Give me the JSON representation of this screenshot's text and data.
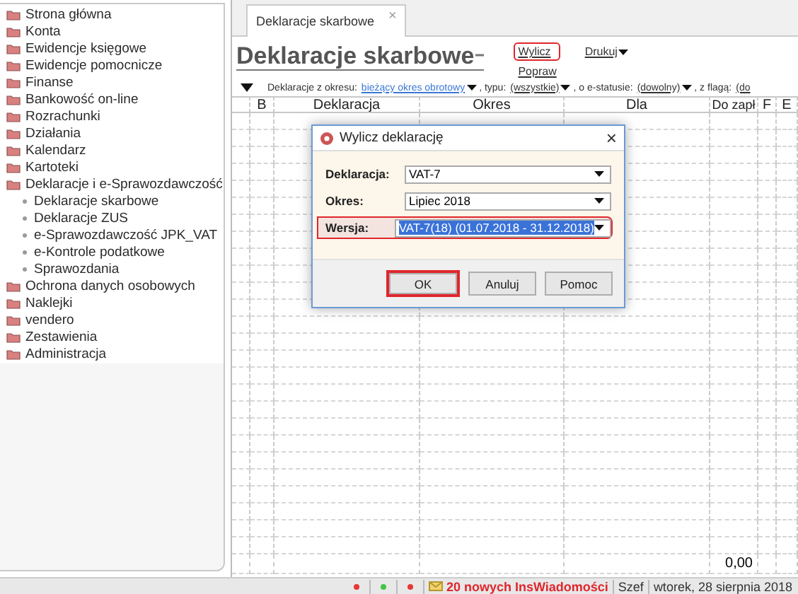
{
  "sidebar": {
    "items": [
      {
        "label": "Strona główna"
      },
      {
        "label": "Konta"
      },
      {
        "label": "Ewidencje księgowe"
      },
      {
        "label": "Ewidencje pomocnicze"
      },
      {
        "label": "Finanse"
      },
      {
        "label": "Bankowość on-line"
      },
      {
        "label": "Rozrachunki"
      },
      {
        "label": "Działania"
      },
      {
        "label": "Kalendarz"
      },
      {
        "label": "Kartoteki"
      },
      {
        "label": "Deklaracje i e-Sprawozdawczość",
        "children": [
          {
            "label": "Deklaracje skarbowe"
          },
          {
            "label": "Deklaracje ZUS"
          },
          {
            "label": "e-Sprawozdawczość JPK_VAT"
          },
          {
            "label": "e-Kontrole podatkowe"
          },
          {
            "label": "Sprawozdania"
          }
        ]
      },
      {
        "label": "Ochrona danych osobowych"
      },
      {
        "label": "Naklejki"
      },
      {
        "label": "vendero"
      },
      {
        "label": "Zestawienia"
      },
      {
        "label": "Administracja"
      }
    ]
  },
  "tabs": [
    {
      "label": "Deklaracje skarbowe",
      "close": "×",
      "selected": true
    }
  ],
  "page_title": "Deklaracje skarbowe",
  "actions": [
    {
      "label": "Wylicz",
      "highlighted": true
    },
    {
      "label": "Popraw",
      "highlighted": false
    }
  ],
  "print_menu": {
    "label": "Drukuj"
  },
  "filters": [
    {
      "label": "Deklaracje z okresu:",
      "value": "bieżący okres obrotowy",
      "kind": "link"
    },
    {
      "label": ", typu:",
      "value": "(wszystkie)",
      "kind": "plain"
    },
    {
      "label": ", o e-statusie:",
      "value": "(dowolny)",
      "kind": "plain"
    },
    {
      "label": ", z flagą:",
      "value": "(do",
      "kind": "plain"
    }
  ],
  "table": {
    "columns": [
      "B",
      "Deklaracja",
      "Okres",
      "Dla",
      "Do zapł",
      "F",
      "E"
    ],
    "footer": {
      "do_zaplaty": "0,00"
    }
  },
  "dialog": {
    "title": "Wylicz deklarację",
    "close": "×",
    "fields": [
      {
        "label": "Deklaracja:",
        "value": "VAT-7",
        "highlighted": false,
        "text_selected": false
      },
      {
        "label": "Okres:",
        "value": "Lipiec 2018",
        "highlighted": false,
        "text_selected": false
      },
      {
        "label": "Wersja:",
        "value": "VAT-7(18) (01.07.2018 - 31.12.2018)",
        "highlighted": true,
        "text_selected": true
      }
    ],
    "buttons": [
      {
        "label": "OK",
        "highlighted": true
      },
      {
        "label": "Anuluj",
        "highlighted": false
      },
      {
        "label": "Pomoc",
        "highlighted": false
      }
    ]
  },
  "status_bar": {
    "indicators": [
      {
        "color": "#e53935"
      },
      {
        "color": "#43c443"
      },
      {
        "color": "#e53935"
      }
    ],
    "messages": "20 nowych InsWiadomości",
    "user": "Szef",
    "date": "wtorek, 28 sierpnia 2018"
  }
}
